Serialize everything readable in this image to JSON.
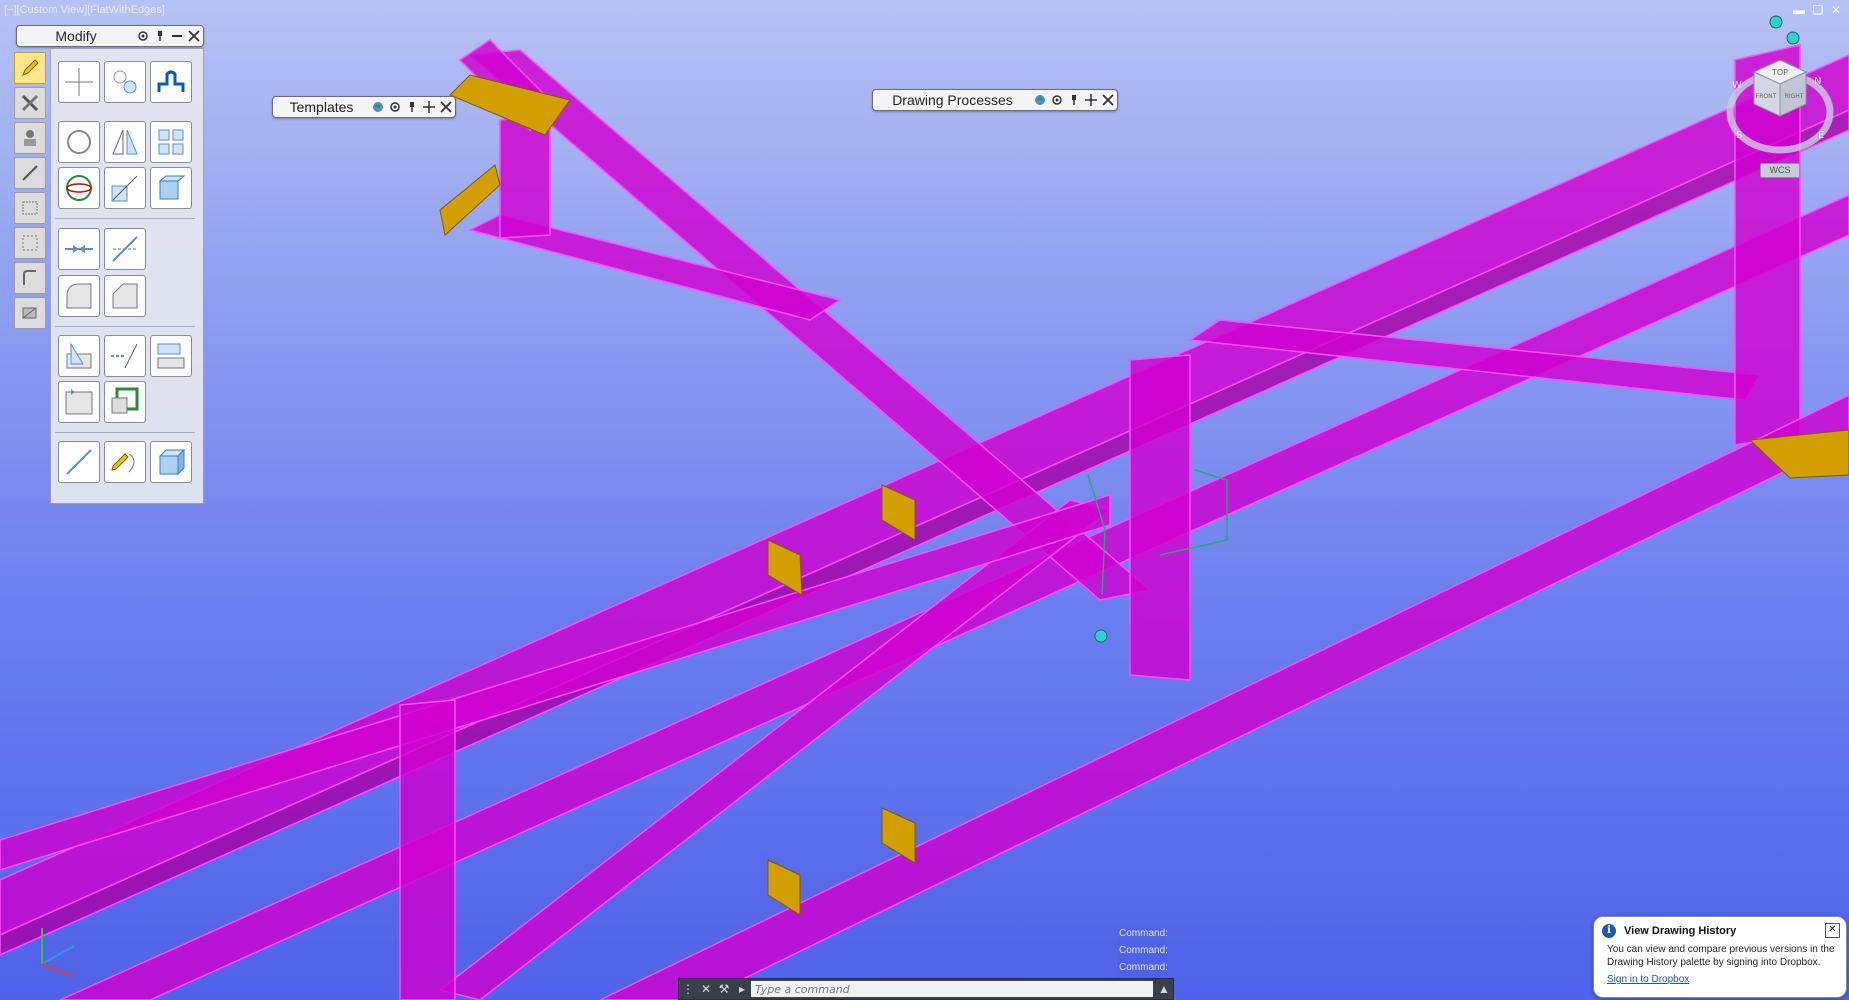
{
  "viewport": {
    "label": "[−][Custom View][FlatWithEdges]",
    "colors": {
      "beam": "#d100d1",
      "beam_edge": "#ff40ff",
      "plate": "#d1a000",
      "bolt": "#2ed3d0",
      "bg_top": "#b7c2f4",
      "bg_bottom": "#4f62ea"
    }
  },
  "window_controls": [
    "minimize-icon",
    "restore-icon",
    "close-icon"
  ],
  "modify_palette": {
    "title": "Modify",
    "icons": [
      "gear-icon",
      "pin-icon",
      "collapse-icon",
      "close-icon"
    ],
    "left_tools": [
      "pencil-icon",
      "tools-icon",
      "user-icon",
      "line-icon",
      "rectangle-icon",
      "selection-icon",
      "curve-icon",
      "layers-icon"
    ],
    "tools": [
      "move-icon",
      "copy-icon",
      "offset-icon",
      "rotate-icon",
      "mirror-icon",
      "array-icon",
      "3d-rotate-icon",
      "scale-icon",
      "3d-array-icon",
      "join-icon",
      "break-icon",
      "fillet-icon",
      "chamfer-icon",
      "slice-icon",
      "extend-icon",
      "align-icon",
      "stretch-icon",
      "boundary-icon",
      "polyline-edit-icon",
      "sketch-icon",
      "solid-edit-icon"
    ]
  },
  "templates_palette": {
    "title": "Templates"
  },
  "drawing_processes_palette": {
    "title": "Drawing Processes"
  },
  "viewcube": {
    "top": "TOP",
    "front": "FRONT",
    "right": "RIGHT",
    "compass": [
      "N",
      "E",
      "S",
      "W"
    ],
    "wcs": "WCS"
  },
  "command_history": [
    "Command:",
    "Command:",
    "Command:"
  ],
  "command_line": {
    "placeholder": "Type a command"
  },
  "notification": {
    "title": "View Drawing History",
    "body": "You can view and compare previous versions in the Drawing History palette by signing into Dropbox.",
    "link": "Sign in to Dropbox"
  }
}
